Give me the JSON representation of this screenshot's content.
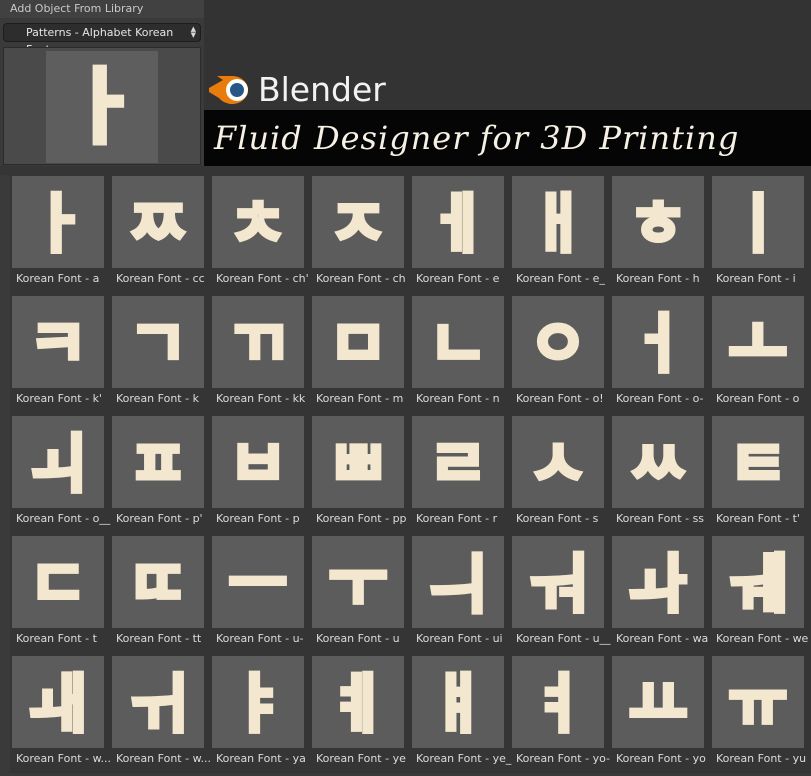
{
  "panel": {
    "title": "Add Object From Library",
    "category_select": "Patterns - Alphabet Korean Font"
  },
  "banner": {
    "app_name": "Blender",
    "subtitle": "Fluid Designer for 3D Printing",
    "accent": "#e87d0d",
    "eye": "#265787"
  },
  "library": {
    "items": [
      {
        "label": "Korean Font - a",
        "glyph": "ㅏ"
      },
      {
        "label": "Korean Font - cc",
        "glyph": "ㅉ"
      },
      {
        "label": "Korean Font - ch'",
        "glyph": "ㅊ"
      },
      {
        "label": "Korean Font - ch",
        "glyph": "ㅈ"
      },
      {
        "label": "Korean Font - e",
        "glyph": "ㅔ"
      },
      {
        "label": "Korean Font - e_",
        "glyph": "ㅐ"
      },
      {
        "label": "Korean Font - h",
        "glyph": "ㅎ"
      },
      {
        "label": "Korean Font - i",
        "glyph": "ㅣ"
      },
      {
        "label": "Korean Font - k'",
        "glyph": "ㅋ"
      },
      {
        "label": "Korean Font - k",
        "glyph": "ㄱ"
      },
      {
        "label": "Korean Font - kk",
        "glyph": "ㄲ"
      },
      {
        "label": "Korean Font - m",
        "glyph": "ㅁ"
      },
      {
        "label": "Korean Font - n",
        "glyph": "ㄴ"
      },
      {
        "label": "Korean Font - o!",
        "glyph": "ㅇ"
      },
      {
        "label": "Korean Font - o-",
        "glyph": "ㅓ"
      },
      {
        "label": "Korean Font - o",
        "glyph": "ㅗ"
      },
      {
        "label": "Korean Font - o__",
        "glyph": "ㅚ"
      },
      {
        "label": "Korean Font - p'",
        "glyph": "ㅍ"
      },
      {
        "label": "Korean Font - p",
        "glyph": "ㅂ"
      },
      {
        "label": "Korean Font - pp",
        "glyph": "ㅃ"
      },
      {
        "label": "Korean Font - r",
        "glyph": "ㄹ"
      },
      {
        "label": "Korean Font - s",
        "glyph": "ㅅ"
      },
      {
        "label": "Korean Font - ss",
        "glyph": "ㅆ"
      },
      {
        "label": "Korean Font - t'",
        "glyph": "ㅌ"
      },
      {
        "label": "Korean Font - t",
        "glyph": "ㄷ"
      },
      {
        "label": "Korean Font - tt",
        "glyph": "ㄸ"
      },
      {
        "label": "Korean Font - u-",
        "glyph": "ㅡ"
      },
      {
        "label": "Korean Font - u",
        "glyph": "ㅜ"
      },
      {
        "label": "Korean Font - ui",
        "glyph": "ㅢ"
      },
      {
        "label": "Korean Font - u__",
        "glyph": "ㅝ"
      },
      {
        "label": "Korean Font - wa",
        "glyph": "ㅘ"
      },
      {
        "label": "Korean Font - we",
        "glyph": "ㅞ"
      },
      {
        "label": "Korean Font - w...",
        "glyph": "ㅙ"
      },
      {
        "label": "Korean Font - w...",
        "glyph": "ㅟ"
      },
      {
        "label": "Korean Font - ya",
        "glyph": "ㅑ"
      },
      {
        "label": "Korean Font - ye",
        "glyph": "ㅖ"
      },
      {
        "label": "Korean Font - ye_",
        "glyph": "ㅒ"
      },
      {
        "label": "Korean Font - yo-",
        "glyph": "ㅕ"
      },
      {
        "label": "Korean Font - yo",
        "glyph": "ㅛ"
      },
      {
        "label": "Korean Font - yu",
        "glyph": "ㅠ"
      }
    ]
  },
  "preview_glyph": "ㅏ"
}
